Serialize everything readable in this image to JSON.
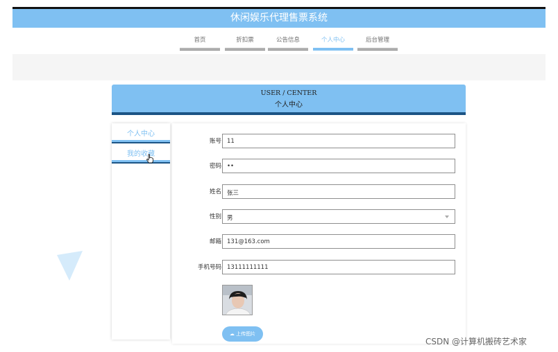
{
  "header": {
    "title": "休闲娱乐代理售票系统"
  },
  "nav": {
    "items": [
      {
        "label": "首页"
      },
      {
        "label": "折扣票"
      },
      {
        "label": "公告信息"
      },
      {
        "label": "个人中心"
      },
      {
        "label": "后台管理"
      }
    ],
    "active": "个人中心"
  },
  "banner": {
    "en": "USER / CENTER",
    "zh": "个人中心"
  },
  "sidebar": {
    "items": [
      {
        "label": "个人中心"
      },
      {
        "label": "我的收藏"
      }
    ]
  },
  "form": {
    "account": {
      "label": "账号",
      "value": "11"
    },
    "password": {
      "label": "密码",
      "value": "••"
    },
    "name": {
      "label": "姓名",
      "value": "张三"
    },
    "gender": {
      "label": "性别",
      "value": "男"
    },
    "email": {
      "label": "邮箱",
      "value": "131@163.com"
    },
    "phone": {
      "label": "手机号码",
      "value": "13111111111"
    },
    "upload_label": "上传图片"
  },
  "watermark": "CSDN @计算机搬砖艺术家",
  "colors": {
    "accent": "#7fc0f2",
    "dark_accent": "#1c5484"
  }
}
